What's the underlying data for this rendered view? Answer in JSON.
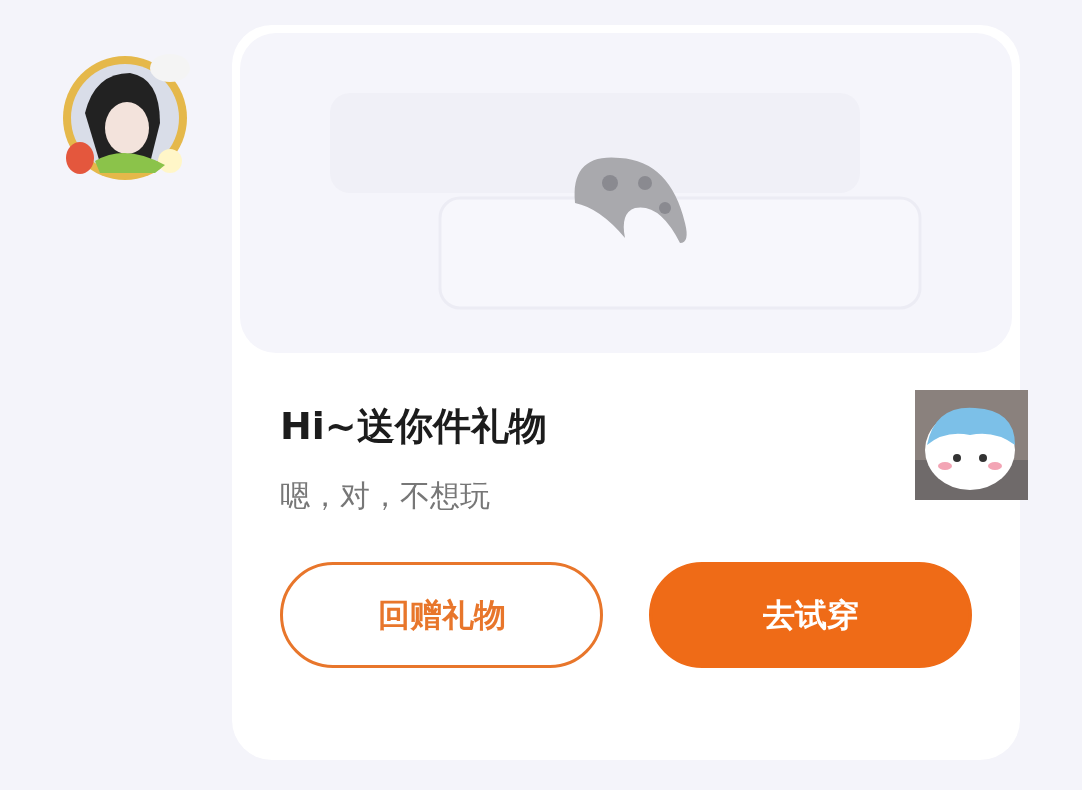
{
  "gift_card": {
    "title": "Hi~送你件礼物",
    "subtitle": "嗯，对，不想玩",
    "buttons": [
      {
        "label": "回赠礼物",
        "kind": "outline"
      },
      {
        "label": "去试穿",
        "kind": "filled"
      }
    ]
  }
}
